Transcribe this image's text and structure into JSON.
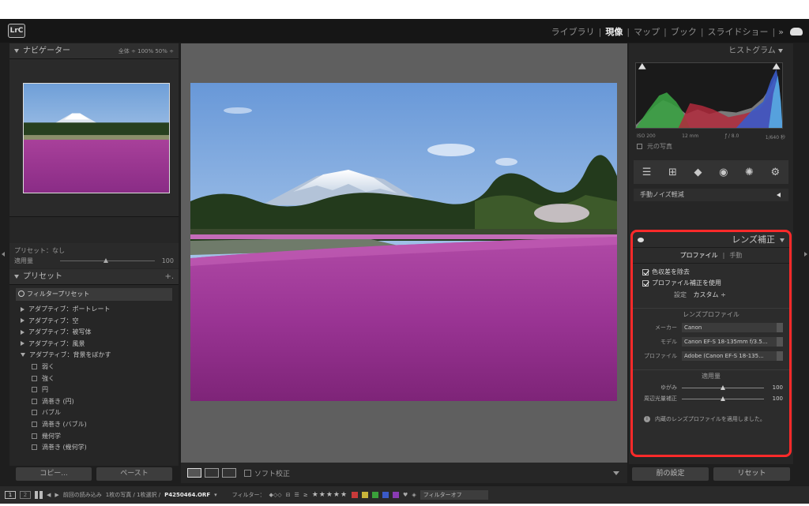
{
  "app": {
    "logo": "LrC"
  },
  "modules": [
    {
      "label": "ライブラリ",
      "active": false
    },
    {
      "label": "現像",
      "active": true
    },
    {
      "label": "マップ",
      "active": false
    },
    {
      "label": "ブック",
      "active": false
    },
    {
      "label": "スライドショー",
      "active": false
    }
  ],
  "modules_more": "»",
  "navigator": {
    "title": "ナビゲーター",
    "zoom_options": "全体 ÷  100%  50%  ÷"
  },
  "preset_amount": {
    "preset_label": "プリセット：なし",
    "amount_label": "適用量",
    "amount_value": "100"
  },
  "presets_panel": {
    "title": "プリセット",
    "add": "+.",
    "filter_label": "フィルタープリセット",
    "groups": [
      {
        "label": "アダプティブ：ポートレート"
      },
      {
        "label": "アダプティブ：空"
      },
      {
        "label": "アダプティブ：被写体"
      },
      {
        "label": "アダプティブ：風景"
      },
      {
        "label": "アダプティブ：背景をぼかす"
      }
    ],
    "items": [
      "弱く",
      "強く",
      "円",
      "渦巻き (円)",
      "バブル",
      "渦巻き (バブル)",
      "幾何学",
      "渦巻き (幾何学)"
    ]
  },
  "left_buttons": {
    "copy": "コピー...",
    "paste": "ペースト"
  },
  "toolbar": {
    "soft_proof": "ソフト校正"
  },
  "histogram": {
    "title": "ヒストグラム",
    "iso": "ISO 200",
    "focal": "12 mm",
    "aperture": "ƒ / 8.0",
    "shutter": "1/640 秒",
    "original_photo": "元の写真"
  },
  "noise_panel": {
    "title": "手動ノイズ軽減"
  },
  "lens": {
    "title": "レンズ補正",
    "tab_profile": "プロファイル",
    "tab_manual": "手動",
    "chk_chromatic": "色収差を除去",
    "chk_profile": "プロファイル補正を使用",
    "setup_label": "設定",
    "setup_value": "カスタム ÷",
    "section_profile": "レンズプロファイル",
    "make_label": "メーカー",
    "make_value": "Canon",
    "model_label": "モデル",
    "model_value": "Canon EF-S 18-135mm f/3.5...",
    "profile_label": "プロファイル",
    "profile_value": "Adobe (Canon EF-S 18-135...",
    "section_amount": "適用量",
    "distortion_label": "ゆがみ",
    "distortion_value": "100",
    "distortion_level": 0.5,
    "vignette_label": "周辺光量補正",
    "vignette_value": "100",
    "vignette_level": 0.5,
    "info": "内蔵のレンズプロファイルを適用しました。"
  },
  "right_buttons": {
    "previous": "前の設定",
    "reset": "リセット"
  },
  "filmstrip": {
    "view1": "1",
    "view2": "2",
    "source": "前回の読み込み",
    "count": "1枚の写真 / 1枚選択 /",
    "filename": "P4250464.ORF",
    "filter_label": "フィルター：",
    "stars": "★★★★★",
    "filter_off": "フィルターオフ"
  },
  "colors": {
    "highlight": "#ff2a2a",
    "panel": "#262626",
    "canvas": "#5f5f5f",
    "label_red": "#c83a3a",
    "label_yellow": "#c8b43a",
    "label_green": "#3aa03a",
    "label_blue": "#3a5ac8",
    "label_purple": "#8a3ab4"
  }
}
